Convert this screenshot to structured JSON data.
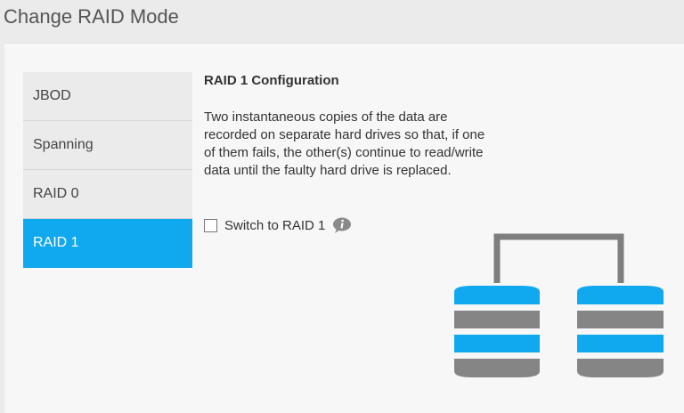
{
  "window": {
    "title": "Change RAID Mode"
  },
  "modes": [
    {
      "label": "JBOD",
      "selected": false
    },
    {
      "label": "Spanning",
      "selected": false
    },
    {
      "label": "RAID 0",
      "selected": false
    },
    {
      "label": "RAID 1",
      "selected": true
    }
  ],
  "details": {
    "heading": "RAID 1 Configuration",
    "description": "Two instantaneous copies of the data are recorded on separate hard drives so that, if one of them fails, the other(s) continue to read/write data until the faulty hard drive is replaced.",
    "switch_label": "Switch to RAID 1",
    "switch_checked": false,
    "info_icon": "info-icon"
  },
  "colors": {
    "accent": "#10a8ee",
    "disk_gray": "#858585",
    "connector": "#7e7e7e"
  }
}
